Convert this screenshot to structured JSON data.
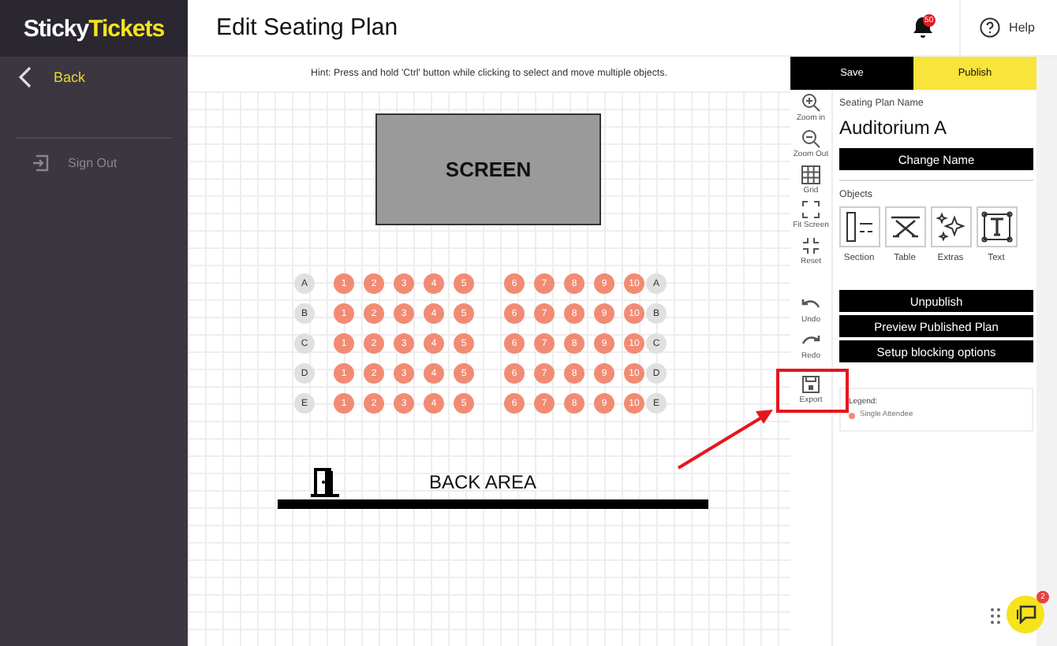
{
  "brand": {
    "part1": "Sticky",
    "part2": "Tickets"
  },
  "sidebar": {
    "items": [
      {
        "label": "Back",
        "kind": "back"
      },
      {
        "label": "Sign Out",
        "kind": "signout"
      }
    ]
  },
  "header": {
    "title": "Edit Seating Plan",
    "notifications": "50",
    "help": "Help"
  },
  "canvas": {
    "hint": "Hint: Press and hold 'Ctrl' button while clicking to select and move multiple objects.",
    "screen_label": "SCREEN",
    "back_area": "BACK AREA",
    "rows": [
      {
        "label": "A",
        "seats": [
          "1",
          "2",
          "3",
          "4",
          "5",
          "6",
          "7",
          "8",
          "9",
          "10"
        ],
        "label_right": "A"
      },
      {
        "label": "B",
        "seats": [
          "1",
          "2",
          "3",
          "4",
          "5",
          "6",
          "7",
          "8",
          "9",
          "10"
        ],
        "label_right": "B"
      },
      {
        "label": "C",
        "seats": [
          "1",
          "2",
          "3",
          "4",
          "5",
          "6",
          "7",
          "8",
          "9",
          "10"
        ],
        "label_right": "C"
      },
      {
        "label": "D",
        "seats": [
          "1",
          "2",
          "3",
          "4",
          "5",
          "6",
          "7",
          "8",
          "9",
          "10"
        ],
        "label_right": "D"
      },
      {
        "label": "E",
        "seats": [
          "1",
          "2",
          "3",
          "4",
          "5",
          "6",
          "7",
          "8",
          "9",
          "10"
        ],
        "label_right": "E"
      }
    ]
  },
  "actions": [
    {
      "label": "Save",
      "kind": "dark"
    },
    {
      "label": "Publish",
      "kind": "yellow"
    }
  ],
  "tools": [
    {
      "label": "Zoom in",
      "kind": "zoom-in",
      "highlighted": false
    },
    {
      "label": "Zoom Out",
      "kind": "zoom-out",
      "highlighted": false
    },
    {
      "label": "Grid",
      "kind": "grid",
      "highlighted": false
    },
    {
      "label": "Fit Screen",
      "kind": "fit",
      "highlighted": false
    },
    {
      "label": "Reset",
      "kind": "reset",
      "highlighted": false
    },
    {
      "label": "Undo",
      "kind": "undo",
      "highlighted": false
    },
    {
      "label": "Redo",
      "kind": "redo",
      "highlighted": false
    },
    {
      "label": "Export",
      "kind": "export",
      "highlighted": true
    }
  ],
  "properties": {
    "name_label": "Seating Plan Name",
    "name": "Auditorium A",
    "change_button": "Change Name",
    "objects_label": "Objects",
    "objects": [
      {
        "label": "Section",
        "kind": "section"
      },
      {
        "label": "Table",
        "kind": "table"
      },
      {
        "label": "Extras",
        "kind": "extras"
      },
      {
        "label": "Text",
        "kind": "text"
      }
    ],
    "buttons": [
      "Unpublish",
      "Preview Published Plan",
      "Setup blocking options"
    ],
    "legend": {
      "title": "Legend:",
      "items": [
        {
          "label": "Single Attendee",
          "color": "#f28b74"
        }
      ]
    }
  },
  "chat": {
    "badge": "2"
  }
}
